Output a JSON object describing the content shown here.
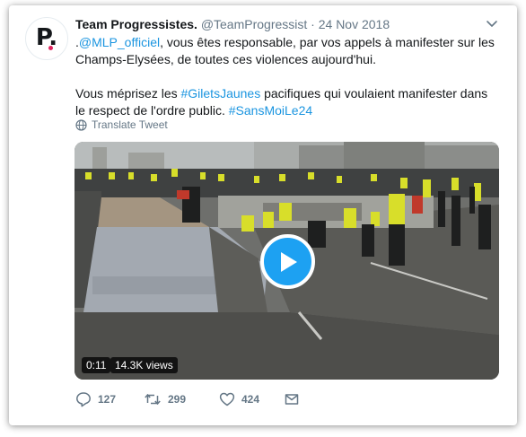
{
  "tweet": {
    "author_name": "Team Progressistes.",
    "author_handle": "@TeamProgressist",
    "separator": "·",
    "date": "24 Nov 2018",
    "avatar_letter": "P.",
    "text": {
      "p1_prefix": ".",
      "mention": "@MLP_officiel",
      "p1_rest": ", vous êtes responsable, par vos appels à manifester sur les Champs-Elysées, de toutes ces violences aujourd'hui.",
      "p2_start": "Vous méprisez les ",
      "hashtag1": "#GiletsJaunes",
      "p2_middle": " pacifiques qui voulaient manifester dans le respect de l'ordre public. ",
      "hashtag2": "#SansMoiLe24"
    },
    "translate_label": "Translate Tweet",
    "video": {
      "duration": "0:11",
      "views": "14.3K views"
    },
    "actions": {
      "replies": "127",
      "retweets": "299",
      "likes": "424"
    }
  },
  "icons": [
    "chevron-down-icon",
    "globe-icon",
    "play-icon",
    "reply-icon",
    "retweet-icon",
    "like-icon",
    "share-icon"
  ],
  "colors": {
    "link": "#1b95e0",
    "play_button": "#1da1f2",
    "text": "#14171a",
    "secondary": "#657786",
    "avatar_dot": "#e0245e"
  }
}
